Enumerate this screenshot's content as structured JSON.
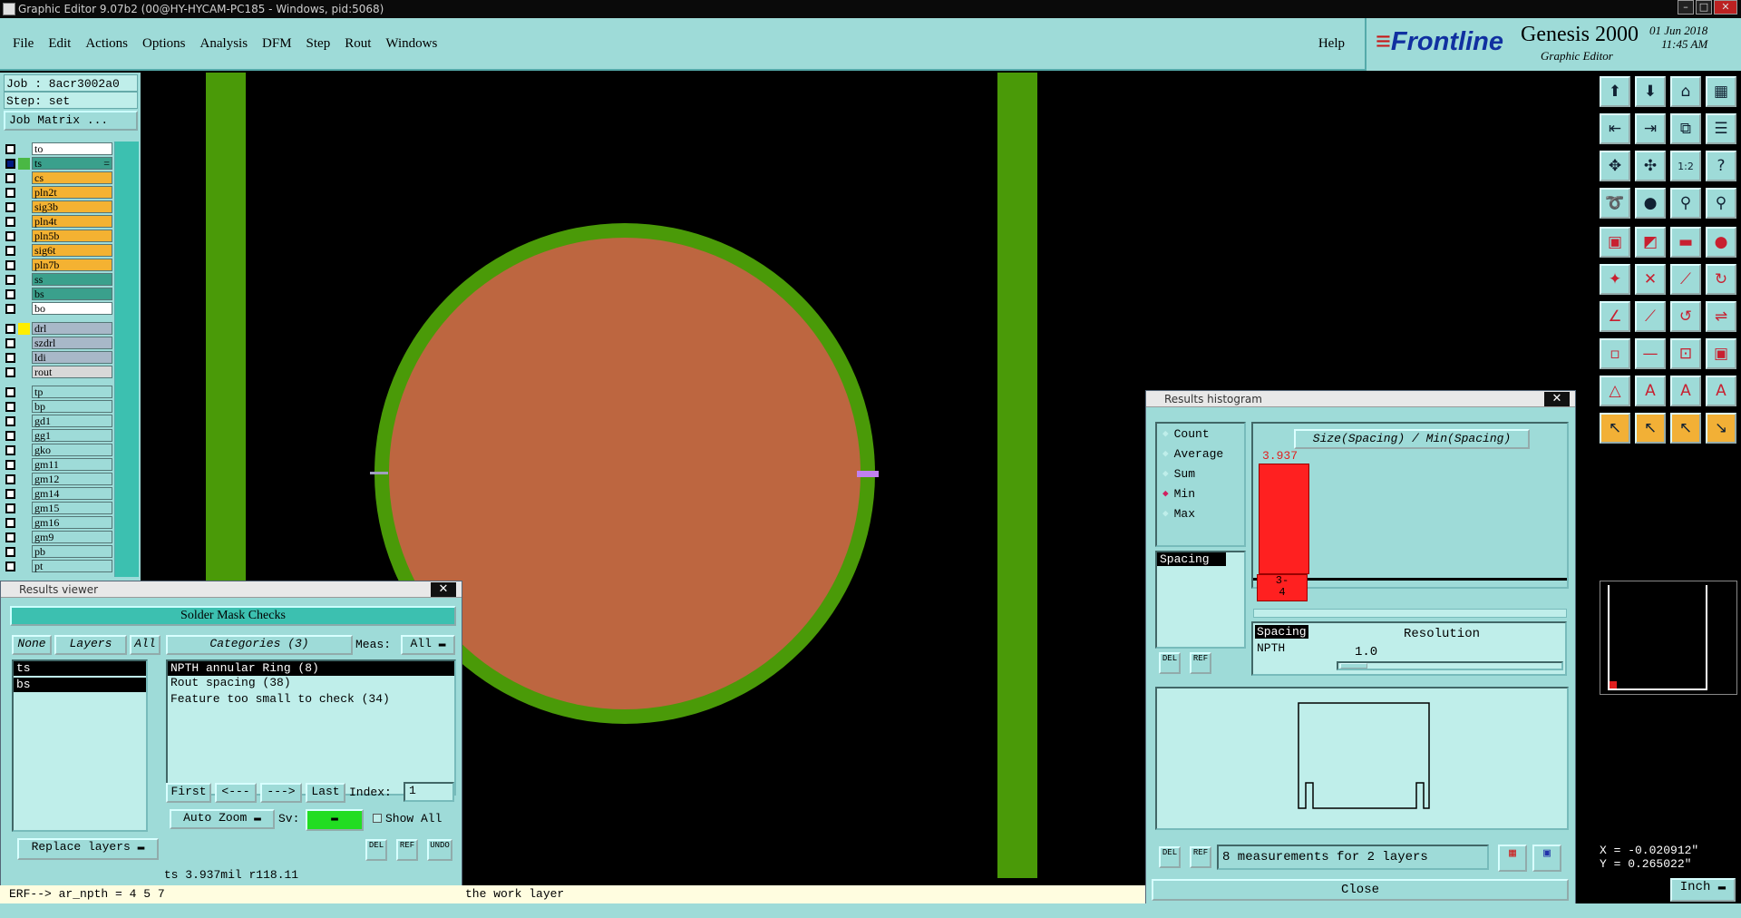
{
  "window": {
    "title": "Graphic Editor 9.07b2 (00@HY-HYCAM-PC185 - Windows, pid:5068)"
  },
  "menu": {
    "items": [
      "File",
      "Edit",
      "Actions",
      "Options",
      "Analysis",
      "DFM",
      "Step",
      "Rout",
      "Windows"
    ],
    "help": "Help"
  },
  "brand": {
    "logo": "Frontline",
    "product": "Genesis 2000",
    "subtitle": "Graphic Editor",
    "date": "01 Jun 2018",
    "time": "11:45 AM"
  },
  "job": {
    "job_label": "Job : 8acr3002a0",
    "step_label": "Step: set",
    "matrix_button": "Job Matrix ..."
  },
  "layers": [
    {
      "name": "to",
      "color": "#ffffff",
      "group": 1
    },
    {
      "name": "ts",
      "color": "#3aa08c",
      "group": 1,
      "selected": true,
      "suffix": "="
    },
    {
      "name": "cs",
      "color": "#f4b232",
      "group": 1
    },
    {
      "name": "pln2t",
      "color": "#f4b232",
      "group": 1
    },
    {
      "name": "sig3b",
      "color": "#f4b232",
      "group": 1
    },
    {
      "name": "pln4t",
      "color": "#f4b232",
      "group": 1
    },
    {
      "name": "pln5b",
      "color": "#f4b232",
      "group": 1
    },
    {
      "name": "sig6t",
      "color": "#f4b232",
      "group": 1
    },
    {
      "name": "pln7b",
      "color": "#f4b232",
      "group": 1
    },
    {
      "name": "ss",
      "color": "#3aa08c",
      "group": 1
    },
    {
      "name": "bs",
      "color": "#3aa08c",
      "group": 1
    },
    {
      "name": "bo",
      "color": "#ffffff",
      "group": 1
    },
    {
      "name": "drl",
      "color": "#a8b8c8",
      "group": 2,
      "mark": "#ffee00"
    },
    {
      "name": "szdrl",
      "color": "#a8b8c8",
      "group": 2
    },
    {
      "name": "ldi",
      "color": "#a8b8c8",
      "group": 2
    },
    {
      "name": "rout",
      "color": "#d8d8d8",
      "group": 2
    },
    {
      "name": "tp",
      "color": "#9edbd8",
      "group": 3
    },
    {
      "name": "bp",
      "color": "#9edbd8",
      "group": 3
    },
    {
      "name": "gd1",
      "color": "#9edbd8",
      "group": 3
    },
    {
      "name": "gg1",
      "color": "#9edbd8",
      "group": 3
    },
    {
      "name": "gko",
      "color": "#9edbd8",
      "group": 3
    },
    {
      "name": "gm11",
      "color": "#9edbd8",
      "group": 3
    },
    {
      "name": "gm12",
      "color": "#9edbd8",
      "group": 3
    },
    {
      "name": "gm14",
      "color": "#9edbd8",
      "group": 3
    },
    {
      "name": "gm15",
      "color": "#9edbd8",
      "group": 3
    },
    {
      "name": "gm16",
      "color": "#9edbd8",
      "group": 3
    },
    {
      "name": "gm9",
      "color": "#9edbd8",
      "group": 3
    },
    {
      "name": "pb",
      "color": "#9edbd8",
      "group": 3
    },
    {
      "name": "pt",
      "color": "#9edbd8",
      "group": 3
    }
  ],
  "results_viewer": {
    "title": "Results viewer",
    "header": "Solder Mask Checks",
    "none_btn": "None",
    "layers_btn": "Layers",
    "all_btn": "All",
    "categories_label": "Categories (3)",
    "meas_label": "Meas:",
    "meas_value": "All",
    "layer_list": [
      "ts",
      "bs"
    ],
    "categories": [
      "NPTH annular Ring (8)",
      "Rout spacing (38)",
      "Feature too small to check (34)"
    ],
    "first_btn": "First",
    "prev_btn": "<---",
    "next_btn": "--->",
    "last_btn": "Last",
    "index_label": "Index:",
    "index_value": "1",
    "auto_zoom": "Auto Zoom",
    "sv_label": "Sv:",
    "show_all": "Show All",
    "replace_btn": "Replace layers",
    "del": "DEL",
    "ref": "REF",
    "undo": "UNDO",
    "status": "ts 3.937mil  r118.11"
  },
  "histogram": {
    "title": "Results histogram",
    "modes": [
      "Count",
      "Average",
      "Sum",
      "Min",
      "Max"
    ],
    "selected_mode": "Min",
    "chart_title": "Size(Spacing) / Min(Spacing)",
    "bar_value": "3.937",
    "bar_label": "3-\n4",
    "measure_list": [
      "Spacing"
    ],
    "detail_list": [
      "Spacing",
      "NPTH"
    ],
    "resolution_label": "Resolution",
    "resolution_value": "1.0",
    "measurements": "8 measurements for 2 layers",
    "close_btn": "Close",
    "del": "DEL",
    "ref": "REF"
  },
  "cmdline": {
    "text": "ERF--> ar_npth = 4 5 7",
    "message": "the work layer"
  },
  "coords": {
    "x": "X = -0.020912\"",
    "y": "Y =  0.265022\"",
    "units": "Inch"
  }
}
